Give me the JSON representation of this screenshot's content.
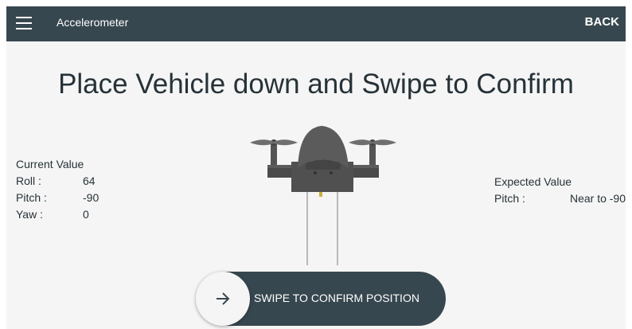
{
  "appbar": {
    "title": "Accelerometer",
    "back_label": "BACK",
    "menu_icon": "hamburger-menu-icon",
    "color": "#37474f"
  },
  "headline": "Place Vehicle down and Swipe to Confirm",
  "current": {
    "title": "Current Value",
    "rows": [
      {
        "label": "Roll :",
        "value": "64"
      },
      {
        "label": "Pitch :",
        "value": "-90"
      },
      {
        "label": "Yaw :",
        "value": "0"
      }
    ]
  },
  "expected": {
    "title": "Expected Value",
    "rows": [
      {
        "label": "Pitch :",
        "value": "Near to -90"
      }
    ]
  },
  "swipe": {
    "label": "SWIPE TO CONFIRM POSITION",
    "knob_icon": "arrow-right-icon",
    "color": "#37474f"
  },
  "illustration": {
    "icon": "drone-icon"
  }
}
